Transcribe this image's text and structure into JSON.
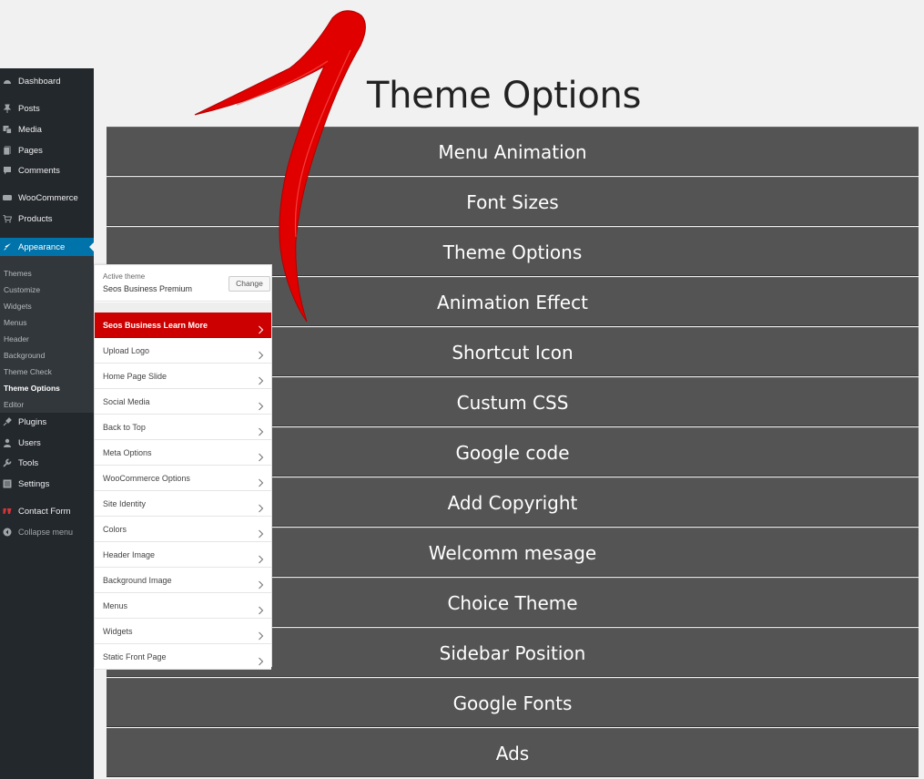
{
  "admin_menu": {
    "items_top": [
      {
        "name": "dashboard",
        "label": "Dashboard",
        "icon": "dashboard-icon"
      },
      {
        "name": "posts",
        "label": "Posts",
        "icon": "pin-icon"
      },
      {
        "name": "media",
        "label": "Media",
        "icon": "media-icon"
      },
      {
        "name": "pages",
        "label": "Pages",
        "icon": "page-icon"
      },
      {
        "name": "comments",
        "label": "Comments",
        "icon": "comment-icon"
      },
      {
        "name": "woocommerce",
        "label": "WooCommerce",
        "icon": "woo-icon"
      },
      {
        "name": "products",
        "label": "Products",
        "icon": "cart-icon"
      }
    ],
    "appearance_label": "Appearance",
    "submenu": [
      "Themes",
      "Customize",
      "Widgets",
      "Menus",
      "Header",
      "Background",
      "Theme Check",
      "Theme Options",
      "Editor"
    ],
    "submenu_current": "Theme Options",
    "items_bottom": [
      {
        "name": "plugins",
        "label": "Plugins",
        "icon": "plug-icon"
      },
      {
        "name": "users",
        "label": "Users",
        "icon": "user-icon"
      },
      {
        "name": "tools",
        "label": "Tools",
        "icon": "wrench-icon"
      },
      {
        "name": "settings",
        "label": "Settings",
        "icon": "settings-icon"
      },
      {
        "name": "contact-form",
        "label": "Contact Form",
        "icon": "contact-form-icon"
      },
      {
        "name": "collapse-menu",
        "label": "Collapse menu",
        "icon": "collapse-icon"
      }
    ],
    "colors": {
      "background": "#23282d",
      "active": "#0073aa",
      "submenu_bg": "#32373c"
    }
  },
  "customizer": {
    "active_theme_label": "Active theme",
    "active_theme_name": "Seos Business Premium",
    "change_label": "Change",
    "sections": [
      "Seos Business Learn More",
      "Upload Logo",
      "Home Page Slide",
      "Social Media",
      "Back to Top",
      "Meta Options",
      "WooCommerce Options",
      "Site Identity",
      "Colors",
      "Header Image",
      "Background Image",
      "Menus",
      "Widgets",
      "Static Front Page"
    ],
    "highlight_color": "#cc0000"
  },
  "theme_options": {
    "title": "Theme Options",
    "items": [
      "Menu Animation",
      "Font Sizes",
      "Theme Options",
      "Animation Effect",
      "Shortcut Icon",
      "Custum CSS",
      "Google code",
      "Add Copyright",
      "Welcomm mesage",
      "Choice Theme",
      "Sidebar Position",
      "Google Fonts",
      "Ads"
    ],
    "bar_color": "#545454"
  },
  "annotation": {
    "arrow_color": "#e00000"
  }
}
